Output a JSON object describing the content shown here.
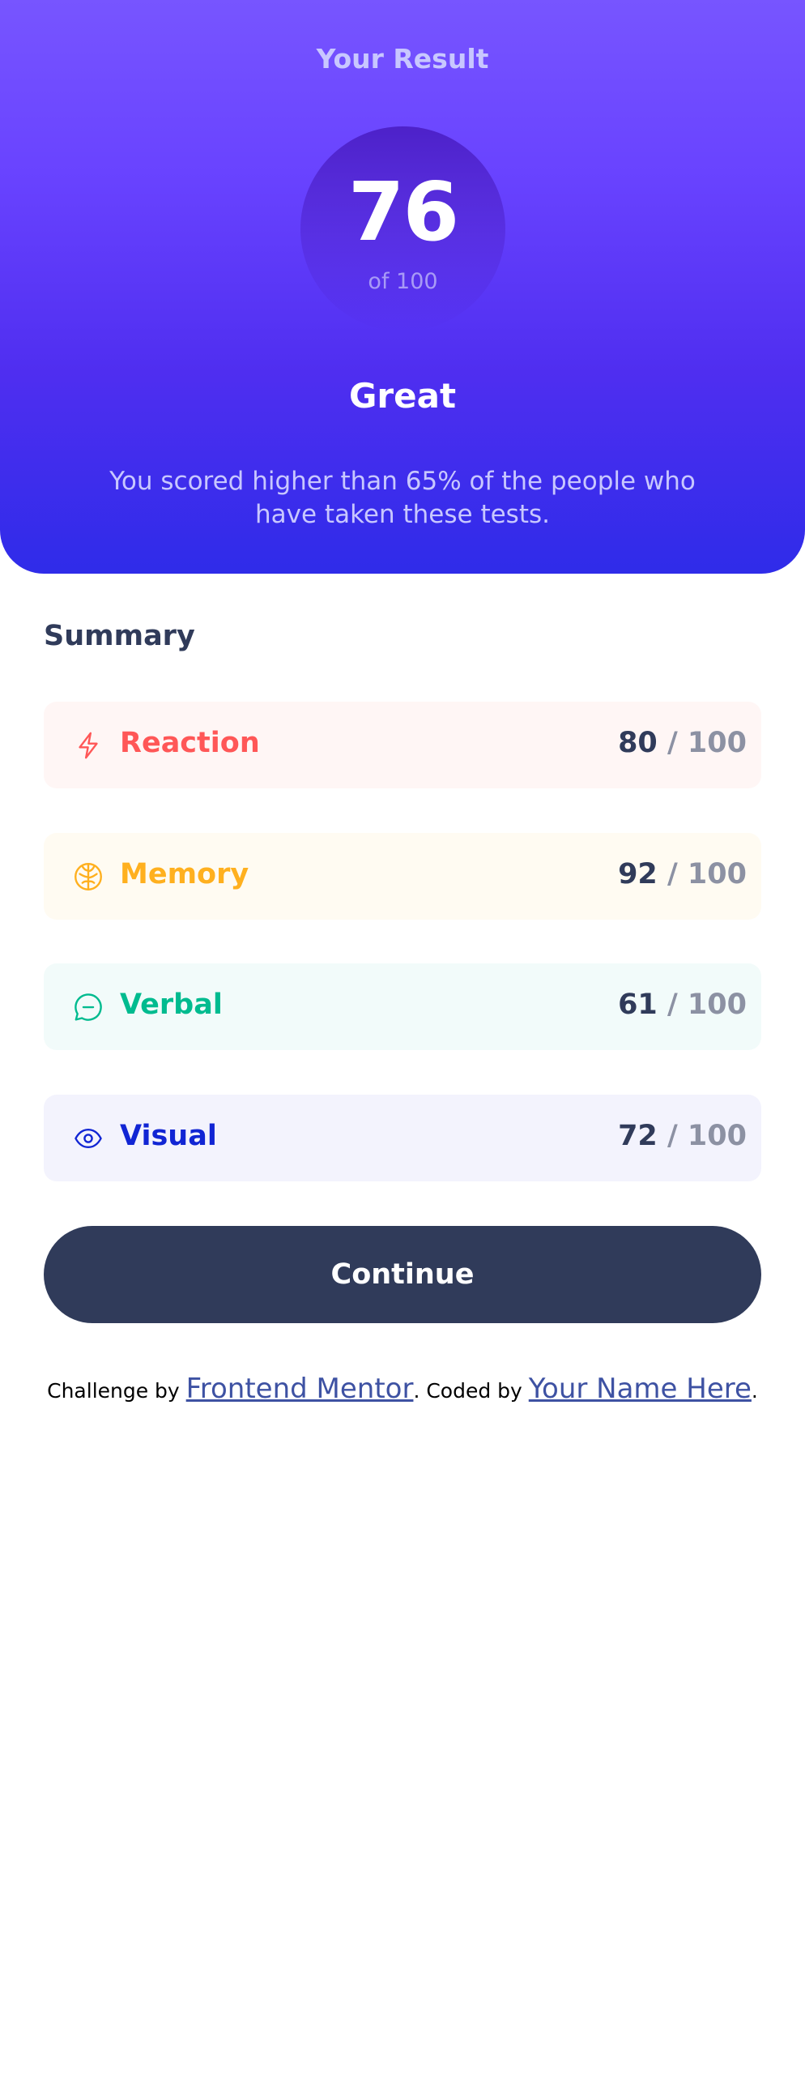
{
  "result": {
    "title": "Your Result",
    "score": "76",
    "score_total": "of 100",
    "verdict": "Great",
    "description": "You scored higher than 65% of the people who have taken these tests."
  },
  "summary": {
    "title": "Summary",
    "items": [
      {
        "label": "Reaction",
        "score": "80",
        "max": " / 100",
        "icon": "lightning-icon",
        "color": "#ff5757",
        "bg": "#fff6f5"
      },
      {
        "label": "Memory",
        "score": "92",
        "max": " / 100",
        "icon": "brain-icon",
        "color": "#ffb01f",
        "bg": "#fffbf2"
      },
      {
        "label": "Verbal",
        "score": "61",
        "max": " / 100",
        "icon": "chat-bubble-icon",
        "color": "#00bb8f",
        "bg": "#f2fbfa"
      },
      {
        "label": "Visual",
        "score": "72",
        "max": " / 100",
        "icon": "eye-icon",
        "color": "#1125d4",
        "bg": "#f3f3fd"
      }
    ]
  },
  "continue_label": "Continue",
  "attribution": {
    "prefix": "Challenge by ",
    "challenge_link": "Frontend Mentor",
    "middle": ". Coded by ",
    "author_link": "Your Name Here",
    "suffix": "."
  }
}
